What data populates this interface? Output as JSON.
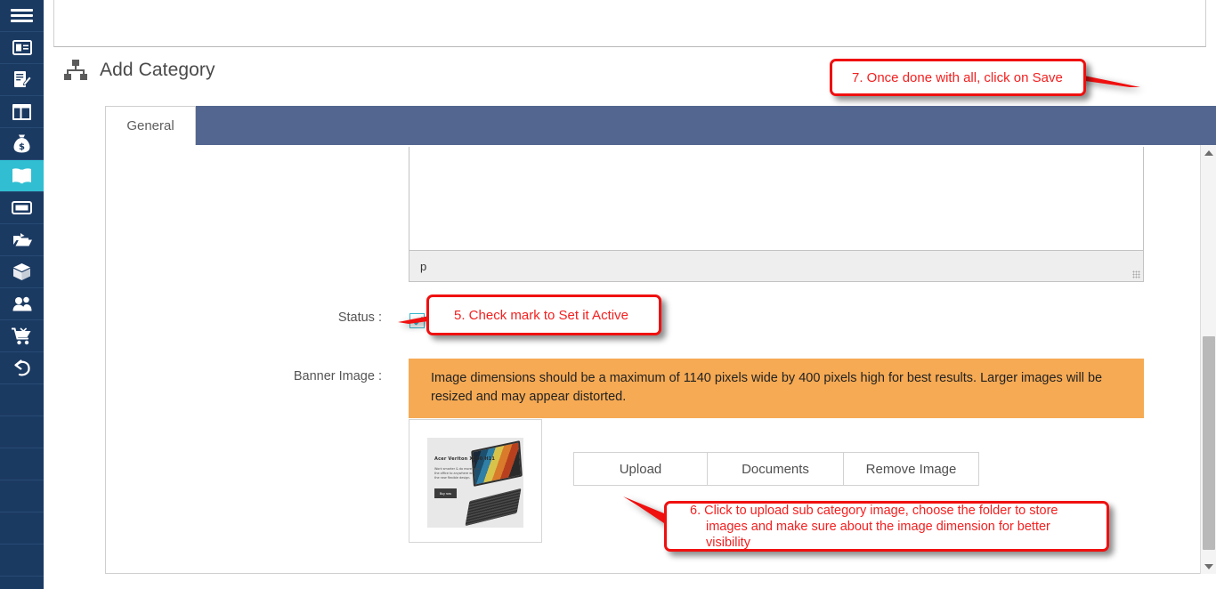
{
  "sidebar": {
    "items": [
      {
        "name": "menu-toggle",
        "icon": "hamburger-icon",
        "label": "Menu",
        "active": false
      },
      {
        "name": "sidebar-item-contacts",
        "icon": "id-card-icon",
        "label": "Contacts",
        "active": false
      },
      {
        "name": "sidebar-item-orders",
        "icon": "document-edit-icon",
        "label": "Orders",
        "active": false
      },
      {
        "name": "sidebar-item-layout",
        "icon": "layout-columns-icon",
        "label": "Layout",
        "active": false
      },
      {
        "name": "sidebar-item-payments",
        "icon": "money-bag-icon",
        "label": "Payments",
        "active": false
      },
      {
        "name": "sidebar-item-catalog",
        "icon": "open-book-icon",
        "label": "Catalog",
        "active": true
      },
      {
        "name": "sidebar-item-banners",
        "icon": "banner-icon",
        "label": "Banners",
        "active": false
      },
      {
        "name": "sidebar-item-media",
        "icon": "folder-open-icon",
        "label": "Media",
        "active": false
      },
      {
        "name": "sidebar-item-products",
        "icon": "box-icon",
        "label": "Products",
        "active": false
      },
      {
        "name": "sidebar-item-customers",
        "icon": "users-icon",
        "label": "Customers",
        "active": false
      },
      {
        "name": "sidebar-item-cart",
        "icon": "shopping-cart-icon",
        "label": "Cart",
        "active": false
      },
      {
        "name": "sidebar-item-returns",
        "icon": "undo-arrow-icon",
        "label": "Returns",
        "active": false
      }
    ],
    "colors": {
      "background": "#1b3a62",
      "active": "#31bed2",
      "divider": "#264a74"
    }
  },
  "header": {
    "page_title": "Add Category",
    "title_icon": "sitemap-icon",
    "save_button": {
      "label": "",
      "icon": "save-disk-icon",
      "color": "#7bc07e"
    },
    "cancel_button": {
      "label": "",
      "icon": "close-x-icon",
      "color": "#eb7b6e"
    }
  },
  "tabs": {
    "bar_color": "#53668f",
    "items": [
      {
        "label": "General",
        "active": true
      }
    ]
  },
  "form": {
    "editor": {
      "status_path": "p",
      "resize_handle": "resize-grip-icon"
    },
    "status": {
      "label": "Status :",
      "checked": true,
      "check_glyph": "✔",
      "accent": "#35b7cd"
    },
    "banner_image": {
      "label": "Banner Image :",
      "warning_text": "Image dimensions should be a maximum of 1140 pixels wide by 400 pixels high for best results. Larger images will be resized and may appear distorted.",
      "warning_bg": "#f6aa54"
    },
    "thumbnail": {
      "alt": "Acer Veriton XC00 H11 laptop banner",
      "headline": "Acer Veriton XC00 H11",
      "subtext": "Work smarter & do more from the office to anywhere with the new flexible design.",
      "cta_label": "Buy now"
    },
    "upload_buttons": [
      {
        "label": "Upload",
        "name": "upload-button"
      },
      {
        "label": "Documents",
        "name": "documents-button"
      },
      {
        "label": "Remove Image",
        "name": "remove-image-button"
      }
    ]
  },
  "callouts": [
    {
      "id": 7,
      "text": "7. Once done with all, click on Save"
    },
    {
      "id": 5,
      "text": "5. Check mark to Set it Active"
    },
    {
      "id": 6,
      "line1": "6.  Click to upload sub category image, choose the folder to store",
      "line2": "images and make sure about the image dimension for better visibility"
    }
  ],
  "scrollbar": {
    "up_arrow": "scroll-up-arrow-icon",
    "down_arrow": "scroll-down-arrow-icon",
    "orientation": "vertical"
  }
}
